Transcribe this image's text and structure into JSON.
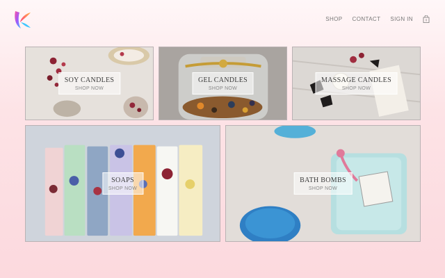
{
  "brand": {
    "logo_icon": "brand-logo-icon"
  },
  "nav": {
    "items": [
      {
        "label": "SHOP"
      },
      {
        "label": "CONTACT"
      },
      {
        "label": "SIGN IN"
      }
    ],
    "cart_icon": "shopping-bag-icon",
    "cart_count": "0"
  },
  "tiles": [
    {
      "title": "SOY CANDLES",
      "cta": "SHOP NOW"
    },
    {
      "title": "GEL CANDLES",
      "cta": "SHOP NOW"
    },
    {
      "title": "MASSAGE CANDLES",
      "cta": "SHOP NOW"
    },
    {
      "title": "SOAPS",
      "cta": "SHOP NOW"
    },
    {
      "title": "BATH BOMBS",
      "cta": "SHOP NOW"
    }
  ],
  "colors": {
    "background": "#fde3e6",
    "nav_text": "#777777",
    "tile_border": "#b9b2b4"
  }
}
